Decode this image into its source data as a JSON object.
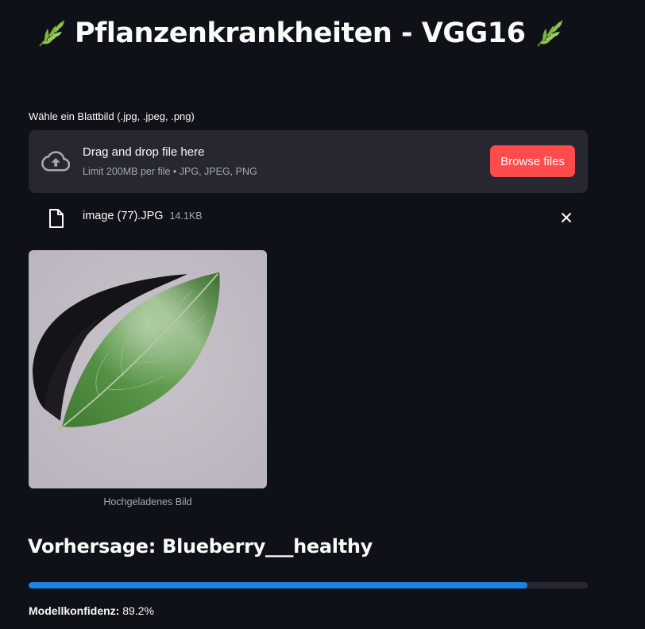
{
  "title": {
    "text": "Pflanzenkrankheiten - VGG16",
    "icon": "herb-icon"
  },
  "uploader": {
    "label": "Wähle ein Blattbild (.jpg, .jpeg, .png)",
    "drop_text": "Drag and drop file here",
    "limit_text": "Limit 200MB per file • JPG, JPEG, PNG",
    "browse_label": "Browse files",
    "icon": "cloud-upload-icon"
  },
  "file": {
    "name": "image (77).JPG",
    "size": "14.1KB",
    "icon": "file-icon",
    "remove_icon": "close-icon"
  },
  "image": {
    "caption": "Hochgeladenes Bild"
  },
  "result": {
    "prediction": "Vorhersage: Blueberry___healthy",
    "progress": 0.892,
    "confidence_label": "Modellkonfidenz:",
    "confidence_value": "89.2%"
  },
  "colors": {
    "background": "#0e1117",
    "surface": "#262730",
    "accent": "#ff4b4b",
    "progress": "#1c83e1",
    "muted_text": "#a3a8b4"
  }
}
